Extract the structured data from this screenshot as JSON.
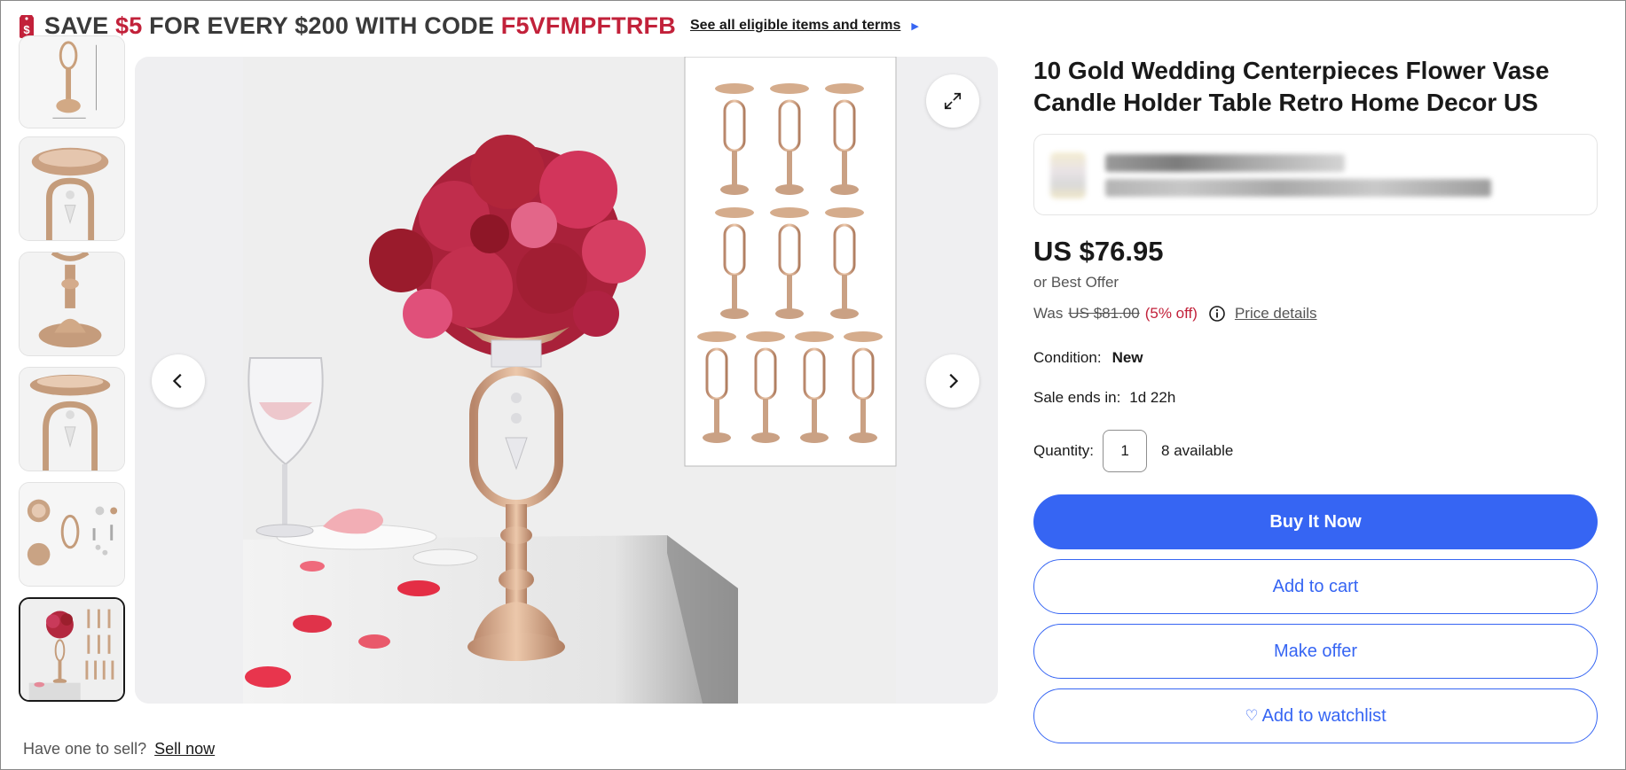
{
  "promo": {
    "save_prefix": "SAVE ",
    "amount": "$5",
    "middle": " FOR EVERY $200 WITH CODE ",
    "code": "F5VFMPFTRFB",
    "link": "See all eligible items and terms",
    "icon": "dollar-tag-icon",
    "accent_color": "#c2213a"
  },
  "thumbnails": [
    {
      "label": "dimensions view"
    },
    {
      "label": "top bowl view"
    },
    {
      "label": "base view"
    },
    {
      "label": "bowl with crystal view"
    },
    {
      "label": "parts view"
    },
    {
      "label": "set with flowers view",
      "selected": true
    }
  ],
  "product": {
    "title": "10 Gold Wedding Centerpieces Flower Vase Candle Holder Table Retro Home Decor US",
    "price": "US $76.95",
    "best_offer": "or Best Offer",
    "was_label": "Was",
    "was_price": "US $81.00",
    "discount": "(5% off)",
    "price_details": "Price details",
    "condition_label": "Condition:",
    "condition_value": "New",
    "sale_ends_label": "Sale ends in:",
    "sale_ends_value": "1d 22h",
    "quantity_label": "Quantity:",
    "quantity_value": "1",
    "available": "8 available"
  },
  "buttons": {
    "buy_now": "Buy It Now",
    "add_to_cart": "Add to cart",
    "make_offer": "Make offer",
    "watchlist": "Add to watchlist"
  },
  "footer": {
    "question": "Have one to sell?",
    "sell_now": "Sell now"
  },
  "colors": {
    "primary": "#3665f3",
    "discount": "#c2213a"
  }
}
